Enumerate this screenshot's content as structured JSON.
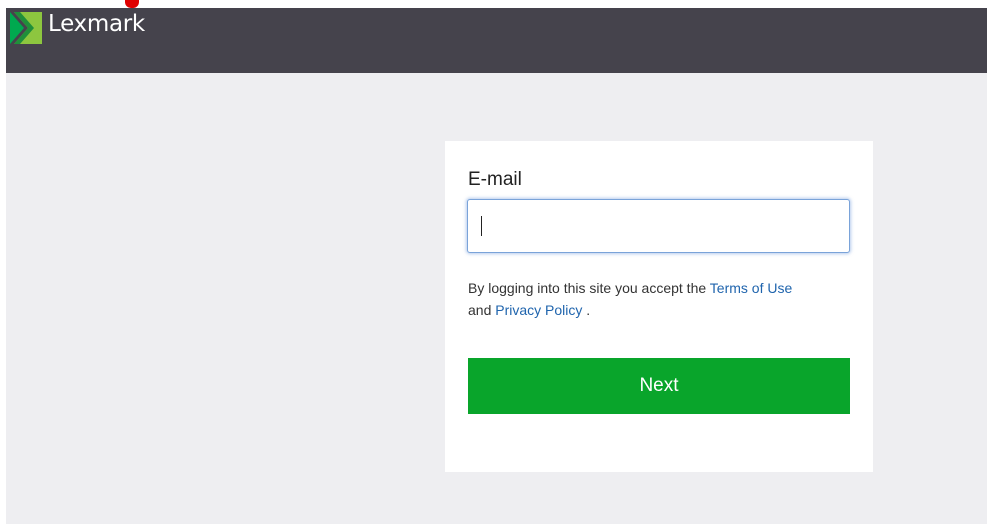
{
  "header": {
    "brand_name": "Lexmark",
    "logo_icon": "lexmark-logo-icon",
    "background_color": "#45434c",
    "logo_colors": [
      "#00a94f",
      "#8dc63f"
    ]
  },
  "login": {
    "email_label": "E-mail",
    "email_value": "",
    "terms_prefix": "By logging into this site you accept the",
    "terms_link": "Terms of Use",
    "terms_and": "and",
    "privacy_link": "Privacy Policy",
    "terms_suffix": ".",
    "next_label": "Next",
    "next_button_color": "#09a52b",
    "link_color": "#1f64ad"
  }
}
